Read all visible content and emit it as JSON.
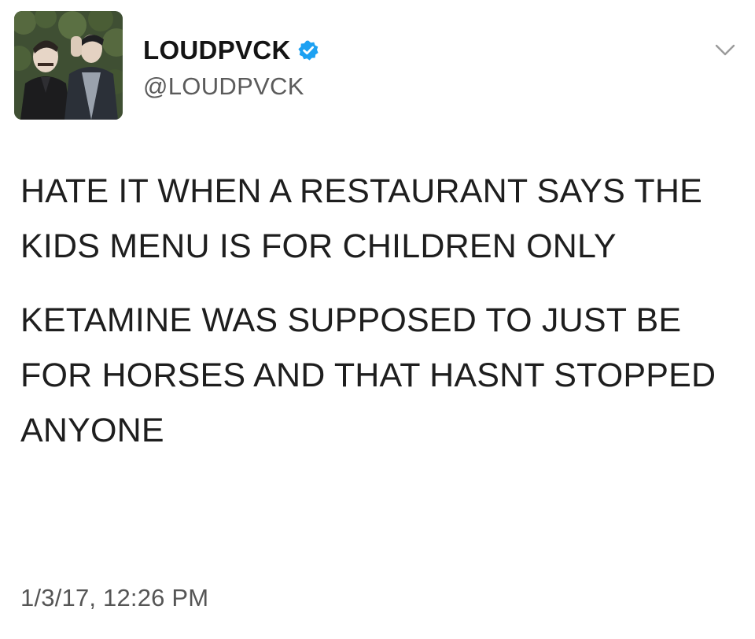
{
  "tweet": {
    "display_name": "LOUDPVCK",
    "handle": "@LOUDPVCK",
    "verified": true,
    "verified_color": "#1da1f2",
    "icons": {
      "verified": "verified-badge-icon",
      "caret": "chevron-down-icon"
    },
    "paragraphs": [
      "HATE IT WHEN A RESTAURANT SAYS THE KIDS MENU IS FOR CHILDREN ONLY",
      "KETAMINE WAS SUPPOSED TO JUST BE FOR HORSES AND THAT HASNT STOPPED ANYONE"
    ],
    "timestamp": "1/3/17, 12:26 PM"
  }
}
